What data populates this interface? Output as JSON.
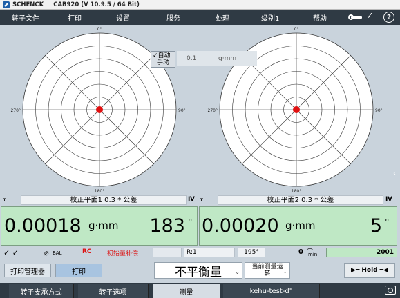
{
  "titlebar": {
    "brand": "SCHENCK",
    "title": "CAB920 (V 10.9.5 / 64 Bit)"
  },
  "menu": [
    "转子文件",
    "打印",
    "设置",
    "服务",
    "处理",
    "级别1",
    "帮助"
  ],
  "help_label": "?",
  "auto_toggle": {
    "check": "✓",
    "line1": "自动",
    "line2": "手动"
  },
  "tolerance_field": {
    "value": "0.1",
    "unit": "g·mm"
  },
  "polar_labels": {
    "top": "0°",
    "right": "90°",
    "bottom": "180°",
    "left": "270°"
  },
  "plane1": {
    "label": "校正平面1  0.3 * 公差",
    "value": "0.00018",
    "unit": "g·mm",
    "angle": "183",
    "deg": "°"
  },
  "plane2": {
    "label": "校正平面2  0.3 * 公差",
    "value": "0.00020",
    "unit": "g·mm",
    "angle": "5",
    "deg": "°"
  },
  "status": {
    "checks": "✓ ✓",
    "bal": "BAL",
    "rc": "RC",
    "init_comp": "初始量补偿",
    "r_label": "R:1",
    "angle_field": "195°",
    "zero": "0",
    "min_label": "min",
    "count": "2001"
  },
  "buttons": {
    "print_manager": "打印管理器",
    "print": "打印",
    "unbalance_select": "不平衡量",
    "current_run_line1": "当前测量运",
    "current_run_line2": "转",
    "hold": "Hold"
  },
  "tabs": [
    "转子支承方式",
    "转子选项",
    "测量",
    "kehu-test-d\""
  ],
  "colors": {
    "menubar": "#2f3a44",
    "value_bg": "#bfe8c5",
    "marker": "#e01010"
  }
}
